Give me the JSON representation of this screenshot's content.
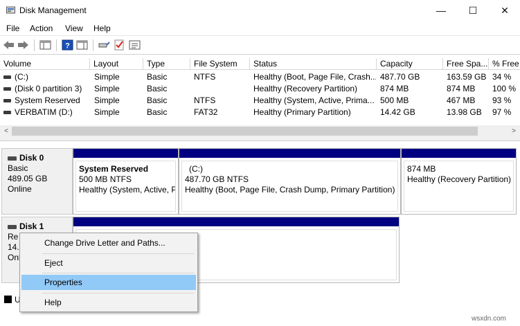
{
  "window": {
    "title": "Disk Management",
    "controls": {
      "minimize": "—",
      "maximize": "☐",
      "close": "✕"
    }
  },
  "menu": [
    "File",
    "Action",
    "View",
    "Help"
  ],
  "toolbar": {
    "icons": [
      "back-arrow-icon",
      "forward-arrow-icon",
      "console-tree-icon",
      "help-icon",
      "action-pane-icon",
      "connect-icon",
      "checklist-icon",
      "properties-sheet-icon"
    ]
  },
  "volume_list": {
    "columns": [
      "Volume",
      "Layout",
      "Type",
      "File System",
      "Status",
      "Capacity",
      "Free Spa...",
      "% Free"
    ],
    "rows": [
      {
        "volume": "(C:)",
        "layout": "Simple",
        "type": "Basic",
        "fs": "NTFS",
        "status": "Healthy (Boot, Page File, Crash...",
        "capacity": "487.70 GB",
        "free": "163.59 GB",
        "pct": "34 %"
      },
      {
        "volume": "(Disk 0 partition 3)",
        "layout": "Simple",
        "type": "Basic",
        "fs": "",
        "status": "Healthy (Recovery Partition)",
        "capacity": "874 MB",
        "free": "874 MB",
        "pct": "100 %"
      },
      {
        "volume": "System Reserved",
        "layout": "Simple",
        "type": "Basic",
        "fs": "NTFS",
        "status": "Healthy (System, Active, Prima...",
        "capacity": "500 MB",
        "free": "467 MB",
        "pct": "93 %"
      },
      {
        "volume": "VERBATIM (D:)",
        "layout": "Simple",
        "type": "Basic",
        "fs": "FAT32",
        "status": "Healthy (Primary Partition)",
        "capacity": "14.42 GB",
        "free": "13.98 GB",
        "pct": "97 %"
      }
    ],
    "scroll_left": "<",
    "scroll_right": ">"
  },
  "disk0": {
    "name": "Disk 0",
    "type": "Basic",
    "size": "489.05 GB",
    "state": "Online",
    "partitions": [
      {
        "name": "System Reserved",
        "size": "500 MB NTFS",
        "status": "Healthy (System, Active, P"
      },
      {
        "name": "(C:)",
        "size": "487.70 GB NTFS",
        "status": "Healthy (Boot, Page File, Crash Dump, Primary Partition)"
      },
      {
        "name": "",
        "size": "874 MB",
        "status": "Healthy (Recovery Partition)"
      }
    ]
  },
  "disk1": {
    "name": "Disk 1",
    "type_partial": "Re",
    "size_partial": "14.",
    "state_partial": "Onl"
  },
  "legend": {
    "label_partial": "U"
  },
  "context_menu": {
    "items": [
      "Change Drive Letter and Paths...",
      "Eject",
      "Properties",
      "Help"
    ],
    "highlighted": "Properties"
  },
  "watermark": "wsxdn.com",
  "colors": {
    "partition_bar": "#000080",
    "menu_highlight": "#91c9f7"
  }
}
